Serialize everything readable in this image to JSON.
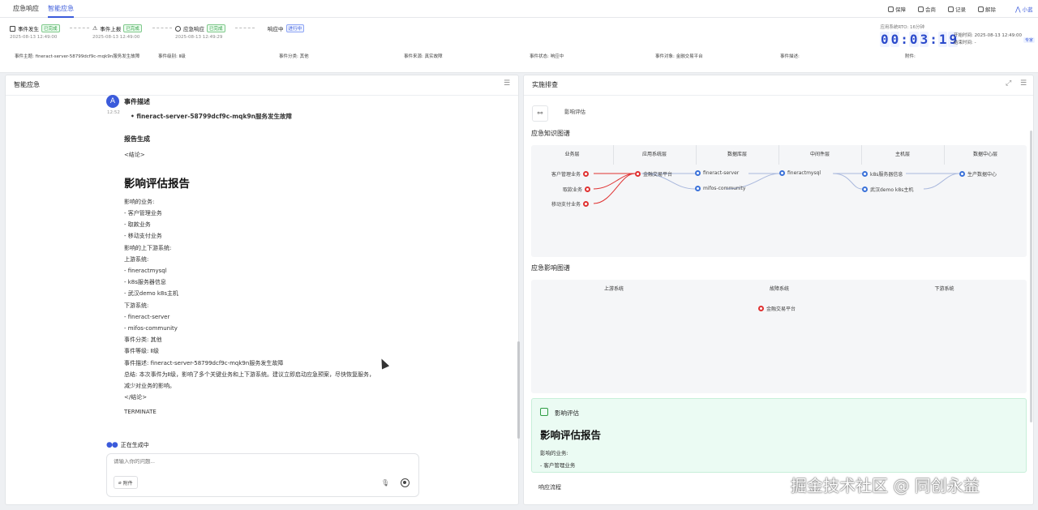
{
  "topbar": {
    "tabs": [
      "应急响应",
      "智能应急"
    ],
    "actions": [
      "保障",
      "会商",
      "记录",
      "解除"
    ],
    "user": "小蓝"
  },
  "status": {
    "steps": [
      {
        "label": "事件发生",
        "badge": "已完成",
        "date": "2025-08-13 12:49:00"
      },
      {
        "label": "事件上报",
        "badge": "已完成",
        "date": "2025-08-13 12:49:00"
      },
      {
        "label": "应急响应",
        "badge": "已完成",
        "date": "2025-08-13 12:49:29"
      },
      {
        "label": "响应中",
        "badge": "进行中",
        "date": ""
      }
    ],
    "rto": "应用系统RTO: 16分钟",
    "timer": [
      "0",
      "0",
      ":",
      "0",
      "3",
      ":",
      "1",
      "9"
    ],
    "start_time": "开始时间: 2025-08-13 12:49:00",
    "end_time": "结束时间: -",
    "version": "专家"
  },
  "meta": {
    "title": "事件主题: fineract-server-58799dcf9c-mqk9n服务发生故障",
    "level": "事件级别: Ⅱ级",
    "category": "事件分类: 其他",
    "source": "事件来源: 真实故障",
    "state": "事件状态: 响应中",
    "object": "事件对象: 金融交易平台",
    "desc": "事件描述:",
    "attach": "附件:"
  },
  "left_panel": {
    "title": "智能应急",
    "time": "12:52",
    "event_desc_title": "事件描述",
    "event_desc_bullet": "fineract-server-58799dcf9c-mqk9n服务发生故障",
    "report_gen": "报告生成",
    "conclusion_open": "<结论>",
    "report_title": "影响评估报告",
    "lines": [
      "影响的业务:",
      "- 客户管理业务",
      "- 取款业务",
      "- 移动支付业务",
      "影响的上下游系统:",
      "上游系统:",
      "- fineractmysql",
      "- k8s服务器信息",
      "- 武汉demo k8s主机",
      "下游系统:",
      "- fineract-server",
      "- mifos-community",
      "事件分类: 其他",
      "事件等级: Ⅱ级",
      "事件描述: fineract-server-58799dcf9c-mqk9n服务发生故障",
      "总结: 本次事件为Ⅱ级，影响了多个关键业务和上下游系统。建议立即启动应急预案，尽快恢复服务，",
      "减少对业务的影响。",
      "</结论>"
    ],
    "terminate": "TERMINATE",
    "generating": "正在生成中",
    "input_placeholder": "请输入你的问题...",
    "attach_label": "附件"
  },
  "right_panel": {
    "title": "实施排查",
    "tab_label": "影响评估",
    "kg_title": "应急知识图谱",
    "kg_columns": [
      "业务层",
      "应用系统层",
      "数据库层",
      "中间件层",
      "主机层",
      "数据中心层"
    ],
    "kg_nodes": {
      "biz": [
        "客户管理业务",
        "取款业务",
        "移动支付业务"
      ],
      "app": "金融交易平台",
      "db": [
        "fineract-server",
        "mifos-community"
      ],
      "mw": "fineractmysql",
      "host": [
        "k8s服务器信息",
        "武汉demo k8s主机"
      ],
      "dc": "生产数据中心"
    },
    "impact_title": "应急影响图谱",
    "impact_columns": [
      "上游系统",
      "故障系统",
      "下游系统"
    ],
    "impact_node": "金融交易平台",
    "assess_label": "影响评估",
    "assess_title": "影响评估报告",
    "assess_lines": [
      "影响的业务:",
      "- 客户管理业务"
    ],
    "flow_tab": "响应流程"
  },
  "watermark": "掘金技术社区 @ 同创永益"
}
